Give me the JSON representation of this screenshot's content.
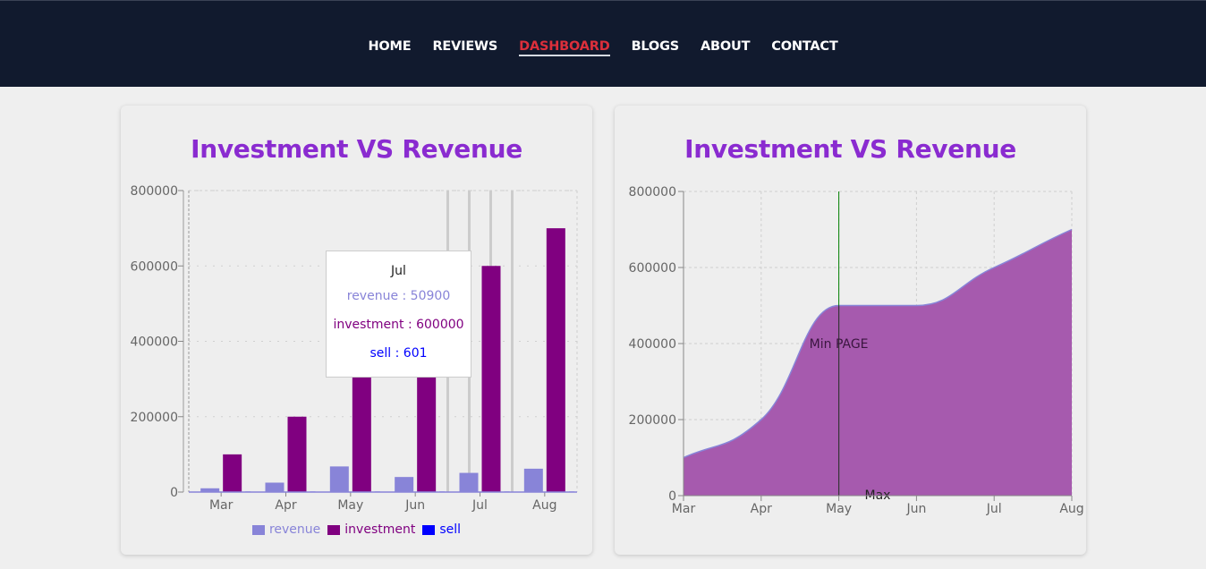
{
  "nav": {
    "items": [
      {
        "label": "HOME",
        "active": false
      },
      {
        "label": "REVIEWS",
        "active": false
      },
      {
        "label": "DASHBOARD",
        "active": true
      },
      {
        "label": "BLOGS",
        "active": false
      },
      {
        "label": "ABOUT",
        "active": false
      },
      {
        "label": "CONTACT",
        "active": false
      }
    ]
  },
  "colors": {
    "revenue": "#8884d8",
    "investment": "#800080",
    "sell": "#0000ff",
    "area_fill": "#a65aae",
    "area_stroke": "#8884d8",
    "title": "#8a2bd0",
    "nav_active": "#dc2f3b"
  },
  "tooltip": {
    "month": "Jul",
    "revenue_text": "revenue : 50900",
    "investment_text": "investment : 600000",
    "sell_text": "sell : 601"
  },
  "reference": {
    "vertical_label": "Min PAGE",
    "vertical_at": "May",
    "horizontal_label": "Max",
    "horizontal_at": 0
  },
  "chart_data": [
    {
      "type": "bar",
      "title": "Investment VS Revenue",
      "categories": [
        "Mar",
        "Apr",
        "May",
        "Jun",
        "Jul",
        "Aug"
      ],
      "series": [
        {
          "name": "revenue",
          "values": [
            10000,
            25000,
            68000,
            40000,
            50900,
            62000
          ]
        },
        {
          "name": "investment",
          "values": [
            100000,
            200000,
            500000,
            500000,
            600000,
            700000
          ]
        },
        {
          "name": "sell",
          "values": [
            100,
            200,
            500,
            400,
            601,
            700
          ]
        }
      ],
      "ylim": [
        0,
        800000
      ],
      "yticks": [
        0,
        200000,
        400000,
        600000,
        800000
      ],
      "grid": true,
      "legend": "bottom",
      "highlighted": "Jul"
    },
    {
      "type": "area",
      "title": "Investment VS Revenue",
      "categories": [
        "Mar",
        "Apr",
        "May",
        "Jun",
        "Jul",
        "Aug"
      ],
      "series": [
        {
          "name": "investment",
          "values": [
            100000,
            200000,
            500000,
            500000,
            600000,
            700000
          ]
        }
      ],
      "ylim": [
        0,
        800000
      ],
      "yticks": [
        0,
        200000,
        400000,
        600000,
        800000
      ],
      "grid": true
    }
  ]
}
